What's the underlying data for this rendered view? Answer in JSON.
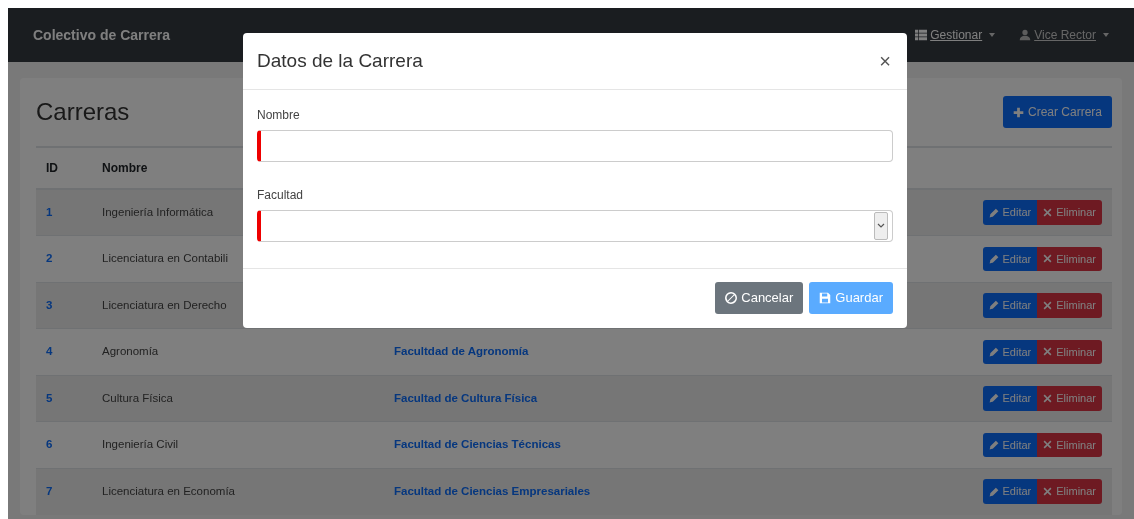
{
  "navbar": {
    "brand": "Colectivo de Carrera",
    "items": [
      {
        "label": "Gestionar",
        "kind": "grid"
      },
      {
        "label": "Vice Rector",
        "kind": "user"
      }
    ]
  },
  "page": {
    "title": "Carreras",
    "create_button": "Crear Carrera",
    "table": {
      "columns": [
        "ID",
        "Nombre"
      ],
      "rows": [
        {
          "id": "1",
          "nombre": "Ingeniería Informática",
          "edit": "Editar",
          "delete": "Eliminar"
        },
        {
          "id": "2",
          "nombre": "Licenciatura en Contabili",
          "edit": "Editar",
          "delete": "Eliminar"
        },
        {
          "id": "3",
          "nombre": "Licenciatura en Derecho",
          "edit": "Editar",
          "delete": "Eliminar"
        },
        {
          "id": "4",
          "nombre": "Agronomía",
          "facultad": "Facultdad de Agronomía",
          "edit": "Editar",
          "delete": "Eliminar"
        },
        {
          "id": "5",
          "nombre": "Cultura Física",
          "facultad": "Facultad de Cultura Física",
          "edit": "Editar",
          "delete": "Eliminar"
        },
        {
          "id": "6",
          "nombre": "Ingeniería Civil",
          "facultad": "Facultad de Ciencias Técnicas",
          "edit": "Editar",
          "delete": "Eliminar"
        },
        {
          "id": "7",
          "nombre": "Licenciatura en Economía",
          "facultad": "Facultad de Ciencias Empresariales",
          "edit": "Editar",
          "delete": "Eliminar"
        }
      ]
    }
  },
  "modal": {
    "title": "Datos de la Carrera",
    "close": "×",
    "fields": [
      {
        "label": "Nombre",
        "kind": "text",
        "invalid": true
      },
      {
        "label": "Facultad",
        "kind": "select",
        "invalid": true
      }
    ],
    "buttons": [
      {
        "label": "Cancelar",
        "kind": "cancel",
        "disabled": false
      },
      {
        "label": "Guardar",
        "kind": "save",
        "disabled": true
      }
    ]
  }
}
